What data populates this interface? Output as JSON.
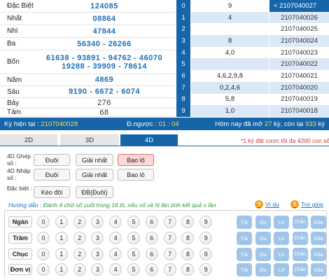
{
  "results": [
    {
      "label": "Đặc Biệt",
      "values": [
        "124085"
      ],
      "gray": false
    },
    {
      "label": "Nhất",
      "values": [
        "08864"
      ],
      "gray": false
    },
    {
      "label": "Nhì",
      "values": [
        "47844"
      ],
      "gray": false
    },
    {
      "label": "Ba",
      "values": [
        "56340 - 26266"
      ],
      "gray": false
    },
    {
      "label": "Bốn",
      "values": [
        "61638 - 93891 - 94762 - 46070",
        "19288 - 39909 - 78614"
      ],
      "gray": false
    },
    {
      "label": "Năm",
      "values": [
        "4869"
      ],
      "gray": false
    },
    {
      "label": "Sáu",
      "values": [
        "9190 - 6672 - 6074"
      ],
      "gray": false
    },
    {
      "label": "Bảy",
      "values": [
        "276"
      ],
      "gray": true
    },
    {
      "label": "Tám",
      "values": [
        "68"
      ],
      "gray": true
    }
  ],
  "loto": [
    {
      "head": "0",
      "tails": "9",
      "draw": "< 2107040027",
      "active": true
    },
    {
      "head": "1",
      "tails": "4",
      "draw": "2107040026",
      "active": false
    },
    {
      "head": "2",
      "tails": "",
      "draw": "2107040025",
      "active": false
    },
    {
      "head": "3",
      "tails": "8",
      "draw": "2107040024",
      "active": false
    },
    {
      "head": "4",
      "tails": "4,0",
      "draw": "2107040023",
      "active": false
    },
    {
      "head": "5",
      "tails": "",
      "draw": "2107040022",
      "active": false
    },
    {
      "head": "6",
      "tails": "4,6,2,9,8",
      "draw": "2107040021",
      "active": false
    },
    {
      "head": "7",
      "tails": "0,2,4,6",
      "draw": "2107040020",
      "active": false
    },
    {
      "head": "8",
      "tails": "5,8",
      "draw": "2107040019",
      "active": false
    },
    {
      "head": "9",
      "tails": "1,0",
      "draw": "2107040018",
      "active": false
    }
  ],
  "status": {
    "draw_label": "Kỳ hiện tại : ",
    "draw_value": "2107040028",
    "countdown_label": "Đ.ngược : ",
    "countdown_value": "01 : 04",
    "today_prefix": "Hôm nay đã mở ",
    "today_opened": "27",
    "today_mid": " kỳ, còn lại ",
    "today_remaining": "933",
    "today_suffix": " kỳ"
  },
  "tabs": {
    "t2d": "2D",
    "t3d": "3D",
    "t4d": "4D"
  },
  "tab_note": "*1 kỳ đặt cược tối đa 4200 con số",
  "bet_groups": [
    {
      "label": "4D Ghép số :",
      "buttons": [
        {
          "text": "Đuôi",
          "selected": false
        },
        {
          "text": "Giải nhất",
          "selected": false
        },
        {
          "text": "Bao lô",
          "selected": true
        }
      ]
    },
    {
      "label": "4D Nhập số :",
      "buttons": [
        {
          "text": "Đuôi",
          "selected": false
        },
        {
          "text": "Giải nhất",
          "selected": false
        },
        {
          "text": "Bao lô",
          "selected": false
        }
      ]
    },
    {
      "label": "Đặc biệt :",
      "buttons": [
        {
          "text": "Kèo đôi",
          "selected": false
        },
        {
          "text": "ĐB(Đuôi)",
          "selected": false
        }
      ]
    }
  ],
  "guide": {
    "prefix": "Hướng dẫn : ",
    "text": "Đánh 4 chữ số cuối trong 16 lô, nếu số về N lần tính kết quả x lần"
  },
  "links": {
    "example": "Ví dụ",
    "help": "Trợ giúp"
  },
  "positions": [
    "Ngàn",
    "Trăm",
    "Chục",
    "Đơn vị"
  ],
  "digits": [
    "0",
    "1",
    "2",
    "3",
    "4",
    "5",
    "6",
    "7",
    "8",
    "9"
  ],
  "quick": [
    "Tài",
    "Xỉu",
    "Lẻ",
    "Chẵn",
    "Xóa"
  ],
  "colors": {
    "primary": "#1565a8",
    "accent_yellow": "#ffd84a",
    "note_red": "#d32f2f",
    "selected_bg": "#fdd8d8",
    "quick_btn": "#9fc6ea",
    "help_icon": "#f2a324"
  }
}
